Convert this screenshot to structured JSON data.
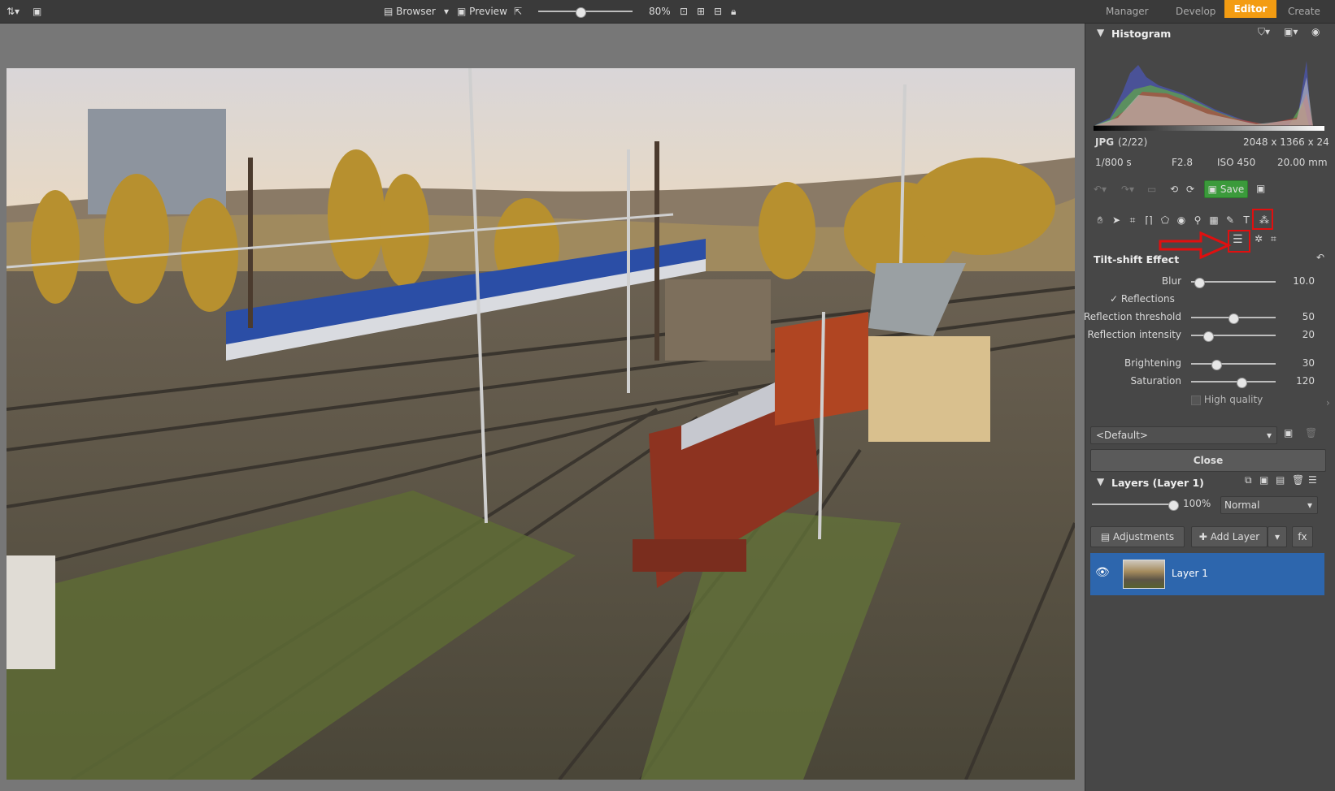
{
  "topbar": {
    "browser_label": "Browser",
    "preview_label": "Preview",
    "zoom_value": "80%",
    "zoom_fraction": 0.45,
    "modules": [
      "Manager",
      "Develop",
      "Editor",
      "Create"
    ],
    "active_module": "Editor"
  },
  "histogram": {
    "title": "Histogram",
    "format": "JPG",
    "index": "(2/22)",
    "dimensions": "2048 x 1366 x 24",
    "shutter": "1/800 s",
    "aperture": "F2.8",
    "iso": "ISO 450",
    "focal": "20.00 mm"
  },
  "toolbar": {
    "save_label": "Save"
  },
  "tiltshift": {
    "title": "Tilt-shift Effect",
    "blur_label": "Blur",
    "blur_value": "10.0",
    "reflections_label": "Reflections",
    "reflections_checked": true,
    "reflection_threshold_label": "Reflection threshold",
    "reflection_threshold_value": "50",
    "reflection_intensity_label": "Reflection intensity",
    "reflection_intensity_value": "20",
    "brightening_label": "Brightening",
    "brightening_value": "30",
    "saturation_label": "Saturation",
    "saturation_value": "120",
    "high_quality_label": "High quality",
    "high_quality_checked": false,
    "preset_value": "<Default>",
    "close_label": "Close",
    "blur_fraction": 0.1,
    "threshold_fraction": 0.5,
    "intensity_fraction": 0.2,
    "brightening_fraction": 0.3,
    "saturation_fraction": 0.6
  },
  "layers": {
    "title": "Layers (Layer 1)",
    "opacity_value": "100%",
    "opacity_fraction": 1.0,
    "blend_mode": "Normal",
    "adjustments_label": "Adjustments",
    "add_layer_label": "Add Layer",
    "fx_label": "fx",
    "items": [
      {
        "name": "Layer 1",
        "visible": true
      }
    ]
  },
  "colors": {
    "accent": "#f39c12",
    "selection": "#2d66ad",
    "highlight_red": "#e10f0f",
    "save_green": "#3b9a3b"
  }
}
